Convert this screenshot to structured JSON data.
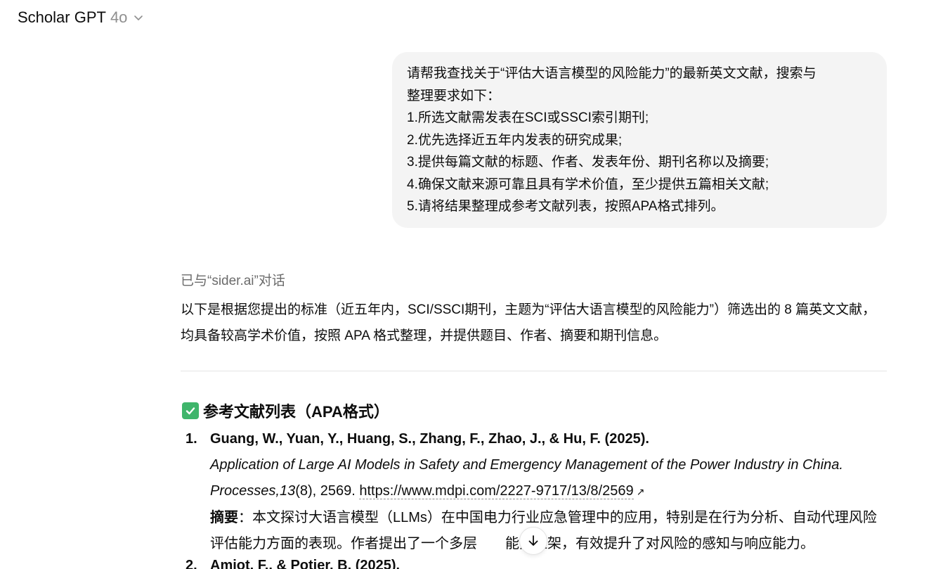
{
  "header": {
    "title": "Scholar GPT",
    "model": "4o"
  },
  "user_message": {
    "lines": [
      "请帮我查找关于“评估大语言模型的风险能力”的最新英文文献，搜索与",
      "整理要求如下：",
      "1.所选文献需发表在SCI或SSCI索引期刊;",
      "2.优先选择近五年内发表的研究成果;",
      "3.提供每篇文献的标题、作者、发表年份、期刊名称以及摘要;",
      "4.确保文献来源可靠且具有学术价值，至少提供五篇相关文献;",
      "5.请将结果整理成参考文献列表，按照APA格式排列。"
    ]
  },
  "assistant": {
    "talked_with": "已与“sider.ai”对话",
    "intro": "以下是根据您提出的标准（近五年内，SCI/SSCI期刊，主题为“评估大语言模型的风险能力”）筛选出的 8 篇英文文献，均具备较高学术价值，按照 APA 格式整理，并提供题目、作者、摘要和期刊信息。",
    "section_title": "参考文献列表（APA格式）",
    "references": [
      {
        "num": "1.",
        "authors": "Guang, W., Yuan, Y., Huang, S., Zhang, F., Zhao, J., & Hu, F. (2025).",
        "title": "Application of Large AI Models in Safety and Emergency Management of the Power Industry in China.",
        "journal": "Processes,",
        "volume": "13",
        "issue_pages": "(8), 2569.",
        "url": "https://www.mdpi.com/2227-9717/13/8/2569",
        "abstract_label": "摘要",
        "abstract_part1": "：本文探讨大语言模型（LLMs）在中国电力行业应急管理中的应用，特别是在行为分析、自动代理风险评估能力方面的表现。作者提出了一个多层",
        "abstract_part2": "能力框架，有效提升了对风险的感知与响应能力。"
      },
      {
        "num": "2.",
        "authors": "Amiot, F., & Potier, B. (2025)."
      }
    ]
  }
}
